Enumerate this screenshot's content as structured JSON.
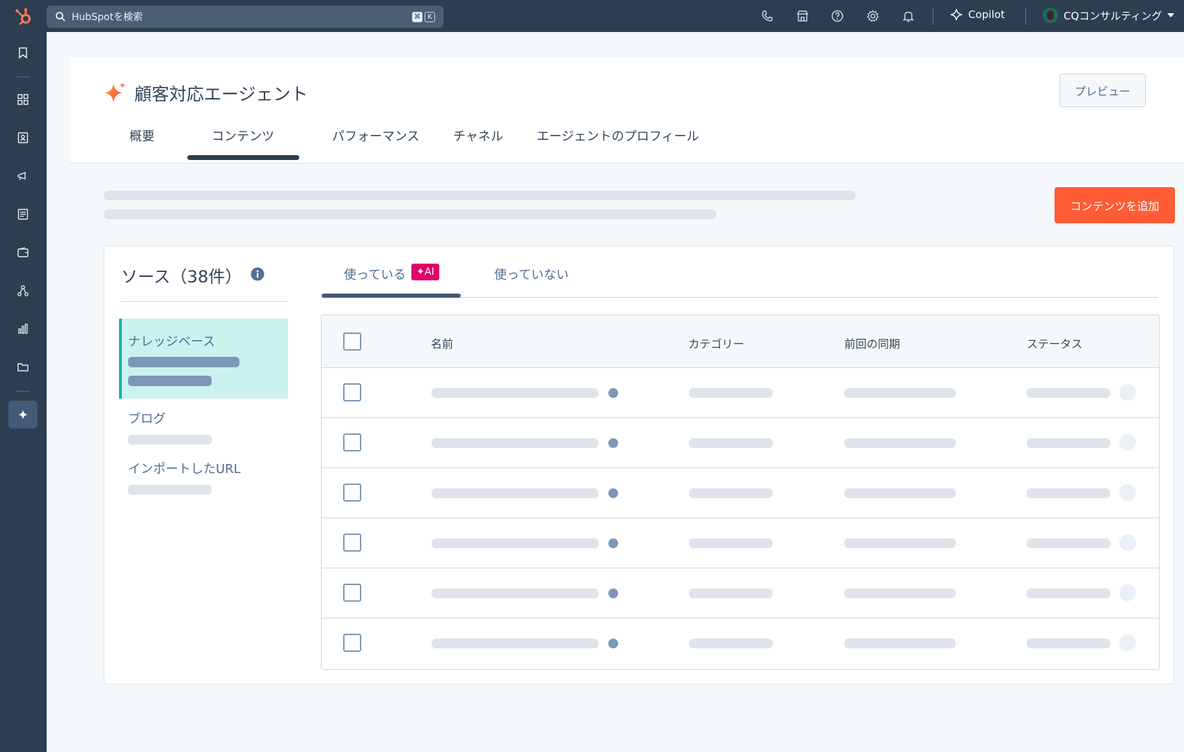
{
  "search": {
    "placeholder": "HubSpotを検索",
    "kbd1": "⌘",
    "kbd2": "K"
  },
  "topbar": {
    "copilot_label": "Copilot",
    "account_name": "CQコンサルティング"
  },
  "header": {
    "title": "顧客対応エージェント",
    "preview_label": "プレビュー",
    "tabs": [
      {
        "label": "概要"
      },
      {
        "label": "コンテンツ"
      },
      {
        "label": "パフォーマンス"
      },
      {
        "label": "チャネル"
      },
      {
        "label": "エージェントのプロフィール"
      }
    ]
  },
  "add_content_label": "コンテンツを追加",
  "sources": {
    "title": "ソース（38件）",
    "items": [
      {
        "label": "ナレッジベース"
      },
      {
        "label": "ブログ"
      },
      {
        "label": "インポートしたURL"
      }
    ]
  },
  "content_tabs": [
    {
      "label": "使っている"
    },
    {
      "label": "使っていない"
    }
  ],
  "ai_badge": "✦AI",
  "table": {
    "columns": [
      "名前",
      "カテゴリー",
      "前回の同期",
      "ステータス"
    ],
    "row_count": 6
  },
  "colors": {
    "brand_orange": "#ff5c35",
    "nav_dark": "#2d3e50",
    "ai_pink": "#e0006b",
    "active_teal": "#00bda5"
  }
}
